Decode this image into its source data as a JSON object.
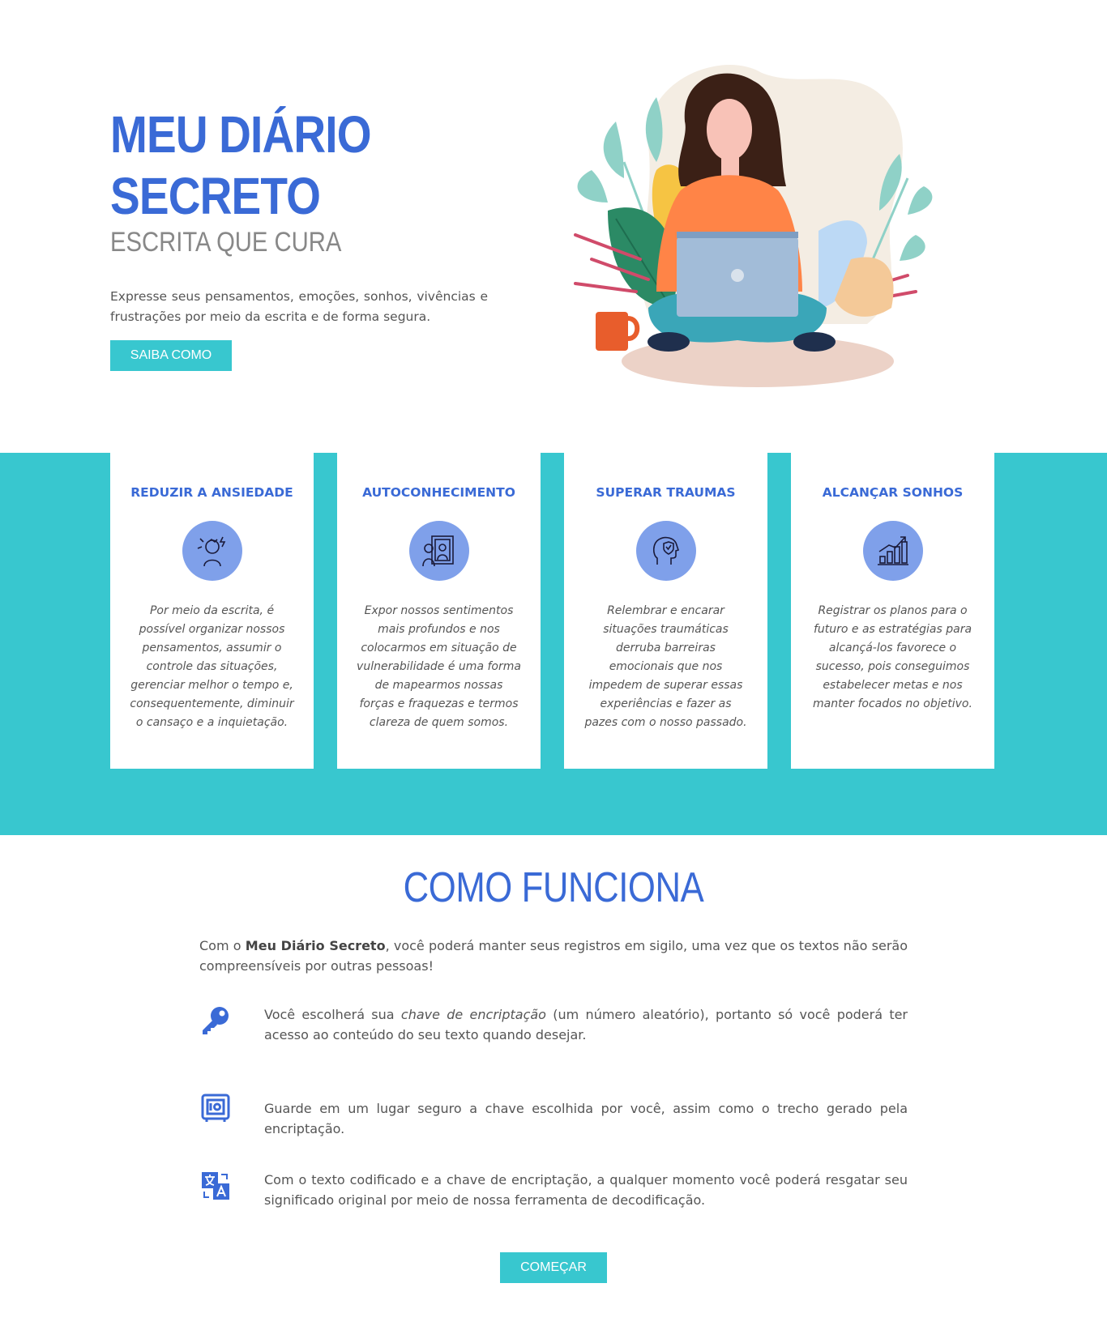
{
  "hero": {
    "title_line1": "MEU DIÁRIO",
    "title_line2": "SECRETO",
    "subtitle": "ESCRITA QUE CURA",
    "text": "Expresse seus pensamentos, emoções, sonhos, vivências e frustrações por meio da escrita e de forma segura.",
    "button": "SAIBA COMO"
  },
  "features": [
    {
      "title": "REDUZIR A ANSIEDADE",
      "icon": "stressed-person-icon",
      "text": "Por meio da escrita, é possível organizar nossos pensamentos, assumir o controle das situações, gerenciar melhor o tempo e, consequentemente, diminuir o cansaço e a inquietação."
    },
    {
      "title": "AUTOCONHECIMENTO",
      "icon": "mirror-reflection-icon",
      "text": "Expor nossos sentimentos mais profundos e nos colocarmos em situação de vulnerabilidade é uma forma de mapearmos nossas forças e fraquezas e termos clareza de quem somos."
    },
    {
      "title": "SUPERAR TRAUMAS",
      "icon": "head-heart-shield-icon",
      "text": "Relembrar e encarar situações traumáticas derruba barreiras emocionais que nos impedem de superar essas experiências e fazer as pazes com o nosso passado."
    },
    {
      "title": "ALCANÇAR SONHOS",
      "icon": "growth-chart-icon",
      "text": "Registrar os planos para o futuro e as estratégias para alcançá-los favorece o sucesso, pois conseguimos estabelecer metas e nos manter focados no objetivo."
    }
  ],
  "how": {
    "title": "COMO FUNCIONA",
    "intro_prefix": "Com o ",
    "intro_bold": "Meu Diário Secreto",
    "intro_suffix": ", você poderá manter seus registros em sigilo, uma vez que os textos não serão compreensíveis por outras pessoas!",
    "steps": [
      {
        "icon": "key-icon",
        "before": "Você escolherá sua ",
        "italic": "chave de encriptação",
        "after": " (um número aleatório), portanto só você poderá ter acesso ao conteúdo do seu texto quando desejar."
      },
      {
        "icon": "safe-icon",
        "text": "Guarde em um lugar seguro a chave escolhida por você, assim como o trecho gerado pela encriptação."
      },
      {
        "icon": "translate-icon",
        "text": "Com o texto codificado e a chave de encriptação, a qualquer momento você poderá resgatar seu significado original por meio de nossa ferramenta de decodificação."
      }
    ],
    "button": "COMEÇAR"
  },
  "colors": {
    "primary": "#3a6ad6",
    "accent": "#38c7cf",
    "icon_bg": "#7fa0ea",
    "text": "#555555"
  }
}
